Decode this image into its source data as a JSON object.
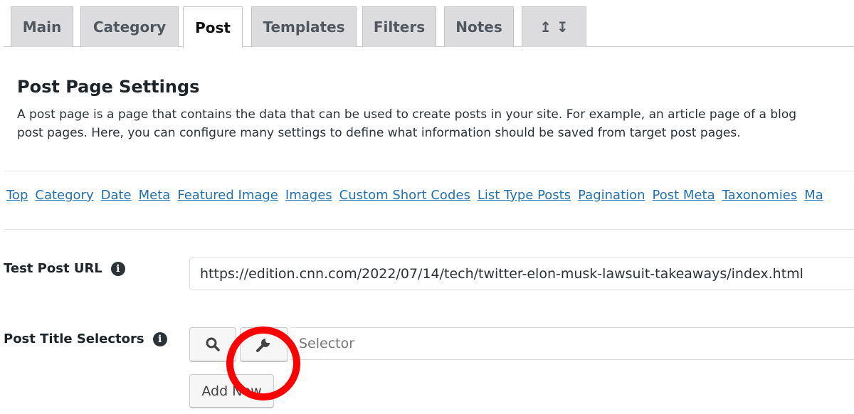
{
  "tabs": [
    {
      "label": "Main"
    },
    {
      "label": "Category"
    },
    {
      "label": "Post",
      "active": true
    },
    {
      "label": "Templates"
    },
    {
      "label": "Filters"
    },
    {
      "label": "Notes"
    },
    {
      "label": "↥ ↧",
      "icon": "import-export-icon"
    }
  ],
  "section": {
    "title": "Post Page Settings",
    "description_line1": "A post page is a page that contains the data that can be used to create posts in your site. For example, an article page of a blog",
    "description_line2": "post pages. Here, you can configure many settings to define what information should be saved from target post pages."
  },
  "nav_links": [
    "Top",
    "Category",
    "Date",
    "Meta",
    "Featured Image",
    "Images",
    "Custom Short Codes",
    "List Type Posts",
    "Pagination",
    "Post Meta",
    "Taxonomies",
    "Ma"
  ],
  "test_url": {
    "label": "Test Post URL",
    "value": "https://edition.cnn.com/2022/07/14/tech/twitter-elon-musk-lawsuit-takeaways/index.html"
  },
  "title_selectors": {
    "label": "Post Title Selectors",
    "placeholder": "Selector",
    "add_new": "Add New"
  },
  "highlight_color": "#ff0000"
}
